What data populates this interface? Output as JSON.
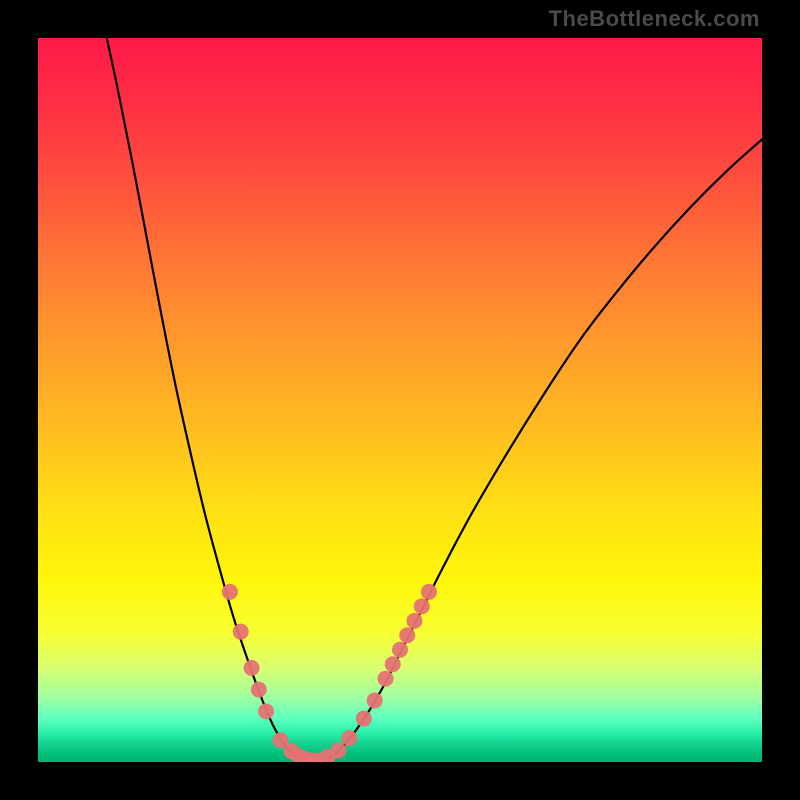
{
  "attribution": "TheBottleneck.com",
  "colors": {
    "frame": "#000000",
    "curve_stroke": "#000000",
    "marker_fill": "#e57373",
    "gradient_top": "#ff1a48",
    "gradient_bottom": "#00b070"
  },
  "chart_data": {
    "type": "line",
    "title": "",
    "xlabel": "",
    "ylabel": "",
    "xlim": [
      0,
      100
    ],
    "ylim": [
      0,
      100
    ],
    "curve_points": [
      {
        "x": 9.5,
        "y": 100.0
      },
      {
        "x": 11.0,
        "y": 93.0
      },
      {
        "x": 13.0,
        "y": 83.0
      },
      {
        "x": 15.0,
        "y": 72.5
      },
      {
        "x": 17.0,
        "y": 62.0
      },
      {
        "x": 19.0,
        "y": 52.0
      },
      {
        "x": 21.0,
        "y": 43.0
      },
      {
        "x": 23.0,
        "y": 34.5
      },
      {
        "x": 25.0,
        "y": 27.0
      },
      {
        "x": 27.0,
        "y": 20.0
      },
      {
        "x": 29.0,
        "y": 14.0
      },
      {
        "x": 31.0,
        "y": 8.5
      },
      {
        "x": 32.5,
        "y": 5.0
      },
      {
        "x": 34.0,
        "y": 2.5
      },
      {
        "x": 35.5,
        "y": 1.0
      },
      {
        "x": 37.0,
        "y": 0.3
      },
      {
        "x": 38.5,
        "y": 0.0
      },
      {
        "x": 40.0,
        "y": 0.5
      },
      {
        "x": 42.0,
        "y": 2.0
      },
      {
        "x": 44.0,
        "y": 4.5
      },
      {
        "x": 46.0,
        "y": 7.5
      },
      {
        "x": 48.0,
        "y": 11.0
      },
      {
        "x": 50.0,
        "y": 15.0
      },
      {
        "x": 53.0,
        "y": 21.0
      },
      {
        "x": 56.0,
        "y": 27.0
      },
      {
        "x": 60.0,
        "y": 34.5
      },
      {
        "x": 65.0,
        "y": 43.0
      },
      {
        "x": 70.0,
        "y": 51.0
      },
      {
        "x": 75.0,
        "y": 58.5
      },
      {
        "x": 80.0,
        "y": 65.0
      },
      {
        "x": 85.0,
        "y": 71.0
      },
      {
        "x": 90.0,
        "y": 76.5
      },
      {
        "x": 95.0,
        "y": 81.5
      },
      {
        "x": 100.0,
        "y": 86.0
      }
    ],
    "marker_points": [
      {
        "x": 26.5,
        "y": 23.5
      },
      {
        "x": 28.0,
        "y": 18.0
      },
      {
        "x": 29.5,
        "y": 13.0
      },
      {
        "x": 30.5,
        "y": 10.0
      },
      {
        "x": 31.5,
        "y": 7.0
      },
      {
        "x": 33.5,
        "y": 3.0
      },
      {
        "x": 35.0,
        "y": 1.5
      },
      {
        "x": 36.0,
        "y": 0.8
      },
      {
        "x": 37.0,
        "y": 0.4
      },
      {
        "x": 38.0,
        "y": 0.2
      },
      {
        "x": 39.0,
        "y": 0.2
      },
      {
        "x": 40.0,
        "y": 0.7
      },
      {
        "x": 41.5,
        "y": 1.6
      },
      {
        "x": 43.0,
        "y": 3.3
      },
      {
        "x": 45.0,
        "y": 6.0
      },
      {
        "x": 46.5,
        "y": 8.5
      },
      {
        "x": 48.0,
        "y": 11.5
      },
      {
        "x": 49.0,
        "y": 13.5
      },
      {
        "x": 50.0,
        "y": 15.5
      },
      {
        "x": 51.0,
        "y": 17.5
      },
      {
        "x": 52.0,
        "y": 19.5
      },
      {
        "x": 53.0,
        "y": 21.5
      },
      {
        "x": 54.0,
        "y": 23.5
      }
    ]
  }
}
